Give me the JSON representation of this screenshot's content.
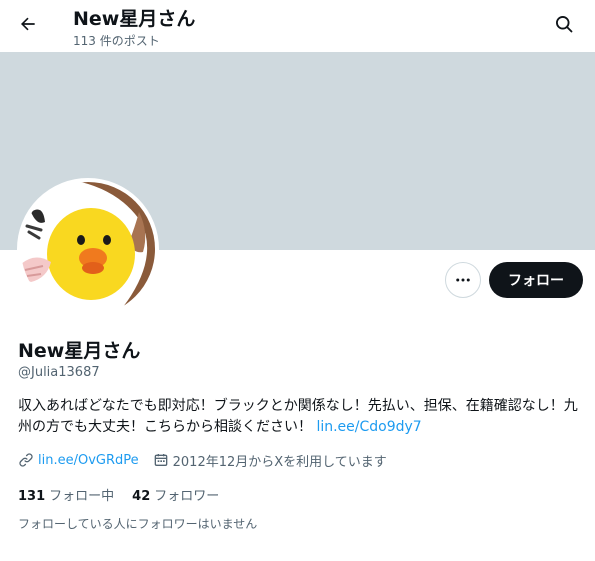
{
  "header": {
    "title": "New星月さん",
    "post_count": "113 件のポスト",
    "back_icon": "back-arrow-icon",
    "search_icon": "search-icon"
  },
  "profile": {
    "name": "New星月さん",
    "handle": "@Julia13687",
    "bio_text": "収入あればどなたでも即対応！ブラックとか関係なし！先払い、担保、在籍確認なし！九州の方でも大丈夫！こちらから相談ください！",
    "bio_link": "lin.ee/Cdo9dy7",
    "website": "lin.ee/OvGRdPe",
    "joined": "2012年12月からXを利用しています",
    "following_count": "131",
    "following_label": "フォロー中",
    "followers_count": "42",
    "followers_label": "フォロワー",
    "followers_note": "フォローしている人にフォロワーはいません"
  },
  "actions": {
    "follow_label": "フォロー",
    "more_icon": "more-dots-icon"
  },
  "colors": {
    "banner": "#cfd9de",
    "link": "#1d9bf0",
    "button_dark": "#0f1419",
    "secondary_text": "#536471"
  }
}
